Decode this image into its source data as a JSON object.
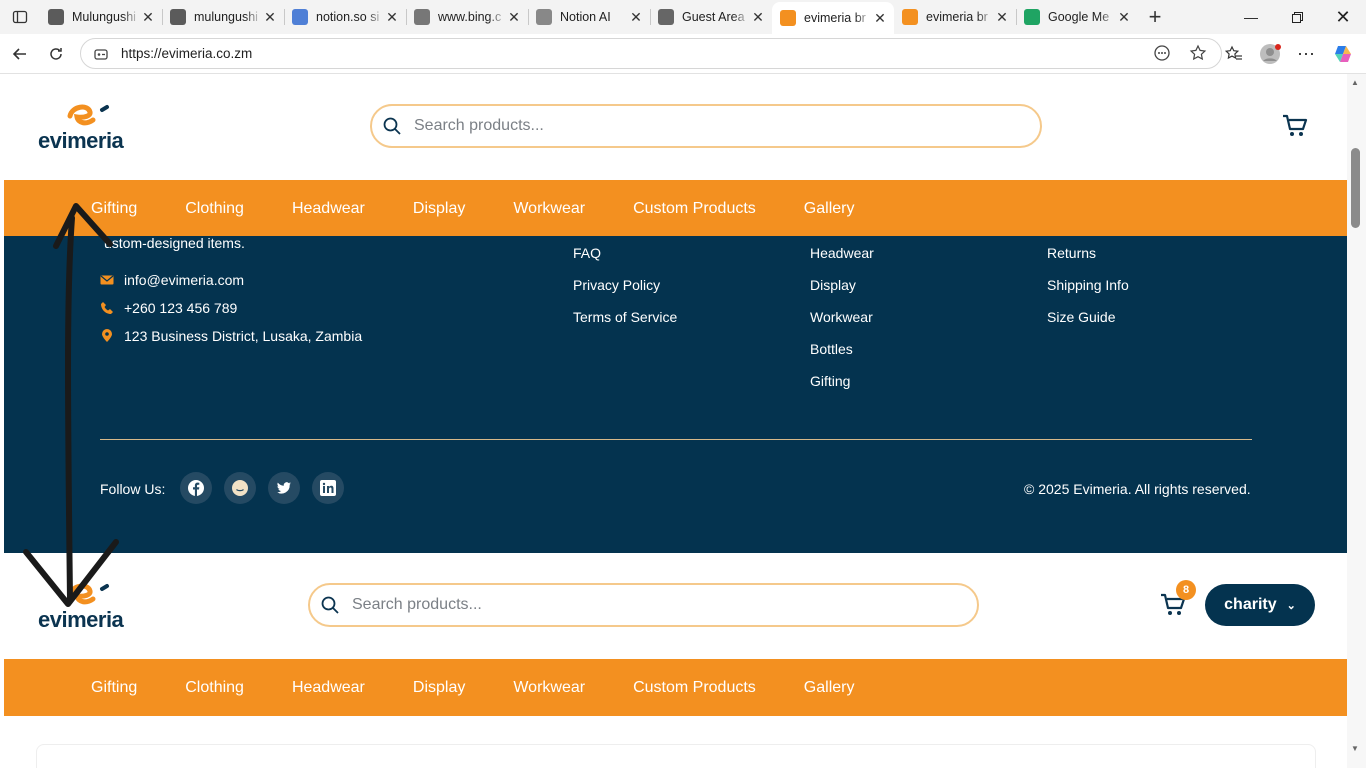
{
  "browser": {
    "tabs": [
      {
        "title": "Mulungushi",
        "icon": "mulungushi-icon",
        "color": "#5b5b5b",
        "active": false
      },
      {
        "title": "mulungushi",
        "icon": "mulungushi-icon",
        "color": "#5b5b5b",
        "active": false
      },
      {
        "title": "notion.so si",
        "icon": "search-icon",
        "color": "#4f7fd6",
        "active": false
      },
      {
        "title": "www.bing.c",
        "icon": "bing-doc-icon",
        "color": "#777777",
        "active": false
      },
      {
        "title": "Notion AI",
        "icon": "notion-icon",
        "color": "#888888",
        "active": false
      },
      {
        "title": "Guest Area",
        "icon": "globe-icon",
        "color": "#666666",
        "active": false
      },
      {
        "title": "evimeria br",
        "icon": "evimeria-icon",
        "color": "#f39020",
        "active": true
      },
      {
        "title": "evimeria br",
        "icon": "evimeria-icon",
        "color": "#f39020",
        "active": false
      },
      {
        "title": "Google Me",
        "icon": "google-meet-icon",
        "color": "#1fa463",
        "active": false
      }
    ],
    "url": "https://evimeria.co.zm"
  },
  "site": {
    "logo_text": "evimeria",
    "search_placeholder": "Search products...",
    "nav": [
      "Gifting",
      "Clothing",
      "Headwear",
      "Display",
      "Workwear",
      "Custom Products",
      "Gallery"
    ],
    "cart_count": "8",
    "user_name": "charity"
  },
  "footer": {
    "tagline_fragment": "ustom-designed items.",
    "email": "info@evimeria.com",
    "phone": "+260 123 456 789",
    "address": "123 Business District, Lusaka, Zambia",
    "col_links_1": [
      "FAQ",
      "Privacy Policy",
      "Terms of Service"
    ],
    "col_links_2": [
      "Headwear",
      "Display",
      "Workwear",
      "Bottles",
      "Gifting"
    ],
    "col_links_3": [
      "Returns",
      "Shipping Info",
      "Size Guide"
    ],
    "follow_label": "Follow Us:",
    "social": [
      "facebook-icon",
      "reddit-icon",
      "twitter-icon",
      "linkedin-icon"
    ],
    "copyright": "© 2025 Evimeria. All rights reserved."
  },
  "colors": {
    "brand_orange": "#f39020",
    "brand_navy": "#04334f",
    "search_border": "#f5c98b",
    "annotation": "#1a1a1a"
  }
}
